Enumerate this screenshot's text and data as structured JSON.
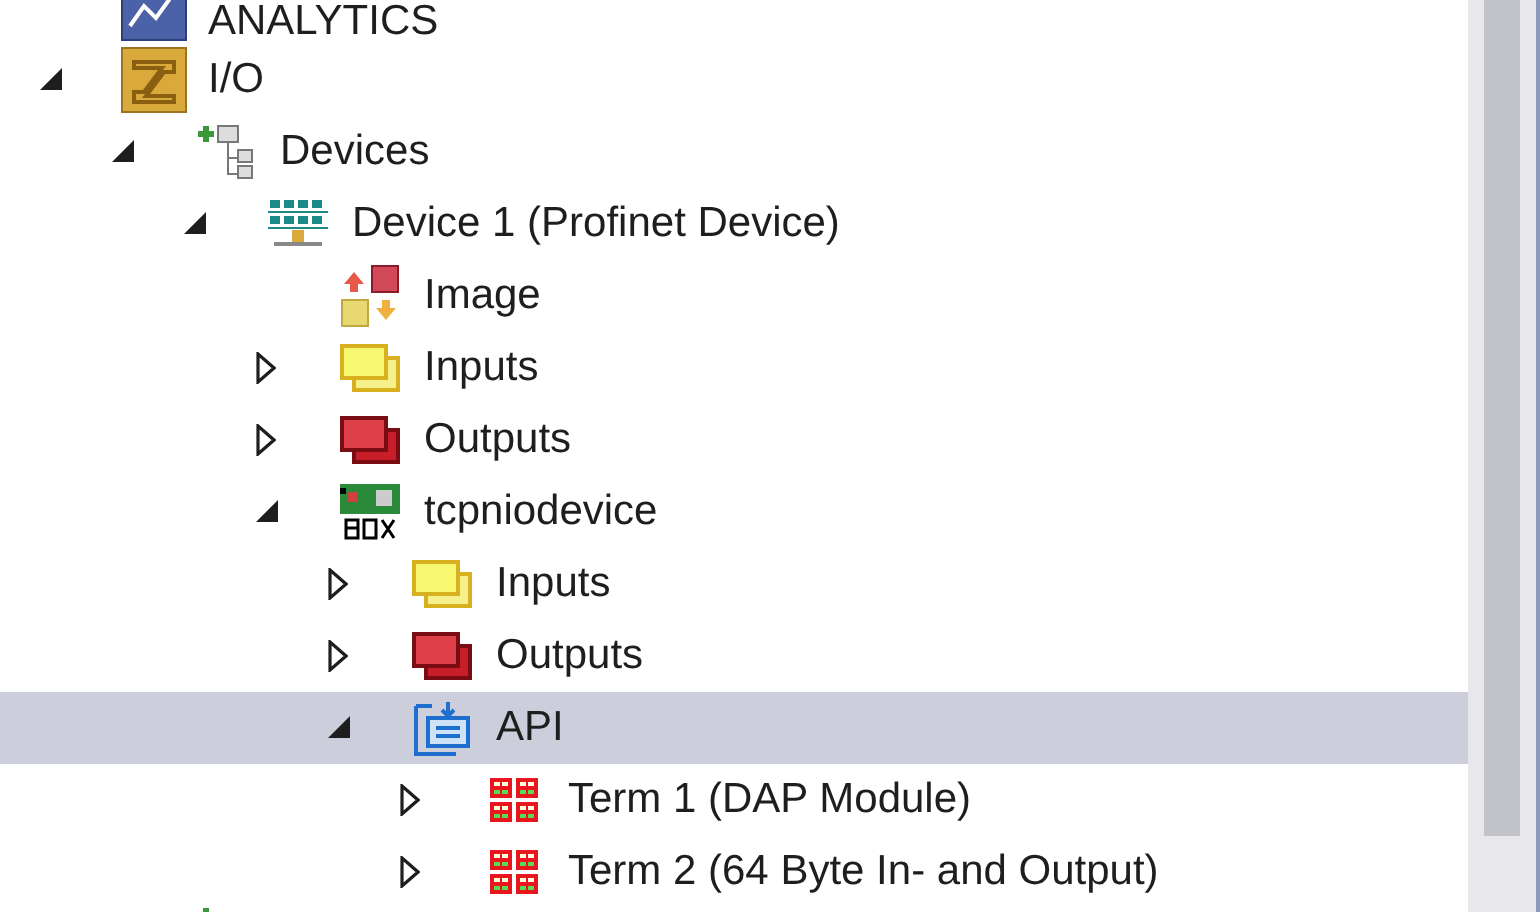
{
  "tree": [
    {
      "label": "ANALYTICS",
      "kind": "analytics",
      "selected": false
    },
    {
      "label": "I/O",
      "kind": "io",
      "expanded": true,
      "selected": false,
      "children": [
        {
          "label": "Devices",
          "kind": "devices",
          "expanded": true,
          "selected": false,
          "children": [
            {
              "label": "Device 1 (Profinet Device)",
              "kind": "network",
              "expanded": true,
              "selected": false,
              "children": [
                {
                  "label": "Image",
                  "kind": "image",
                  "selected": false
                },
                {
                  "label": "Inputs",
                  "kind": "inputs",
                  "expanded": false,
                  "selected": false
                },
                {
                  "label": "Outputs",
                  "kind": "outputs",
                  "expanded": false,
                  "selected": false
                },
                {
                  "label": "tcpniodevice",
                  "kind": "box",
                  "expanded": true,
                  "selected": false,
                  "children": [
                    {
                      "label": "Inputs",
                      "kind": "inputs",
                      "expanded": false,
                      "selected": false
                    },
                    {
                      "label": "Outputs",
                      "kind": "outputs",
                      "expanded": false,
                      "selected": false
                    },
                    {
                      "label": "API",
                      "kind": "api",
                      "expanded": true,
                      "selected": true,
                      "children": [
                        {
                          "label": "Term 1 (DAP Module)",
                          "kind": "term",
                          "expanded": false,
                          "selected": false
                        },
                        {
                          "label": "Term 2 (64 Byte In- and Output)",
                          "kind": "term",
                          "expanded": false,
                          "selected": false
                        }
                      ]
                    }
                  ]
                }
              ]
            }
          ]
        }
      ]
    }
  ]
}
